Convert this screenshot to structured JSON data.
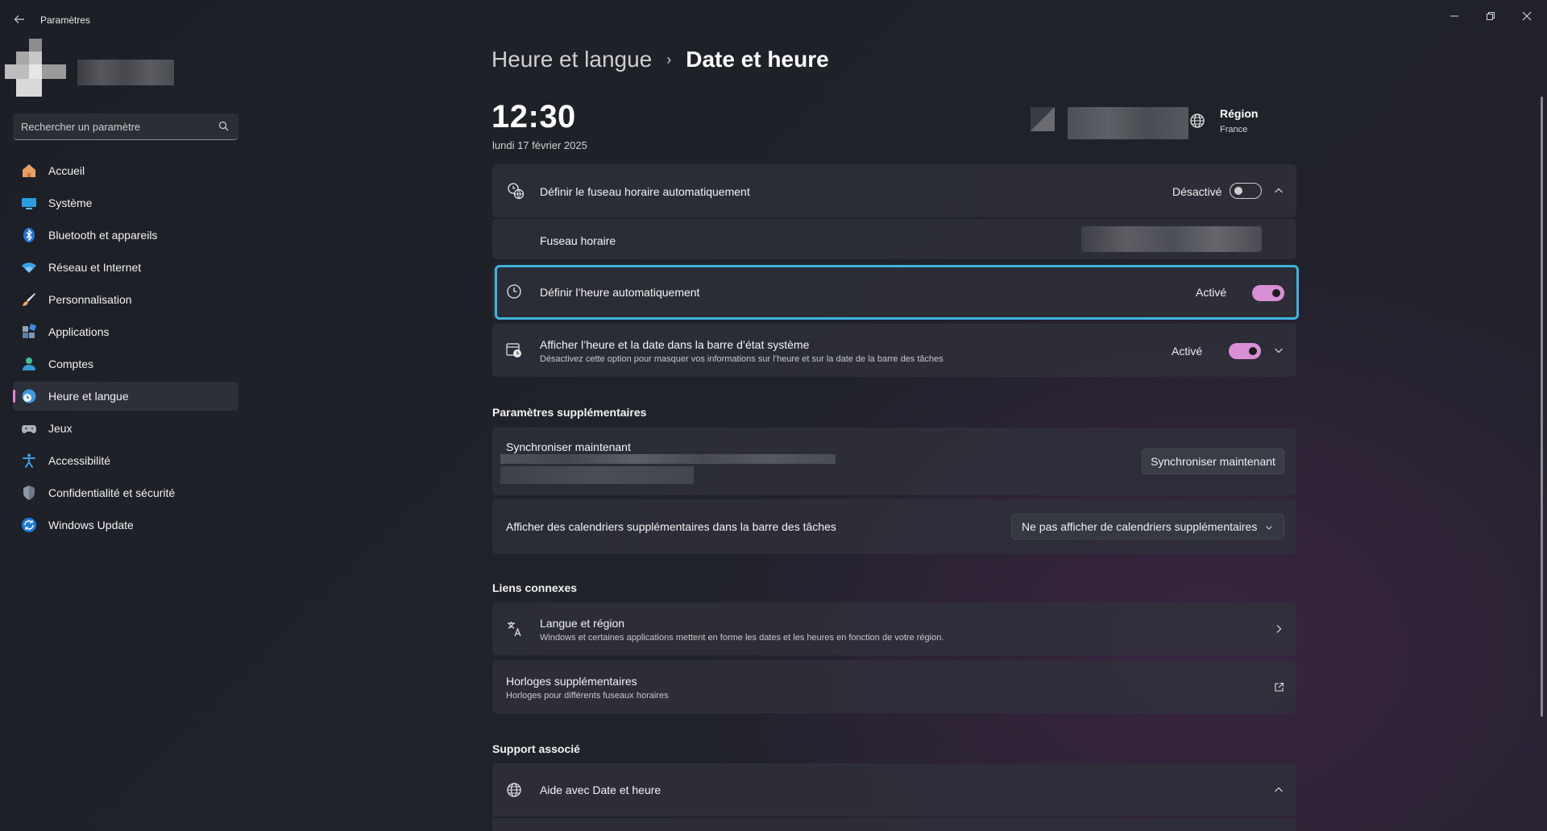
{
  "window": {
    "app_title": "Paramètres",
    "back_icon": "back-arrow-icon",
    "controls": [
      "minimize-icon",
      "restore-icon",
      "close-icon"
    ]
  },
  "search": {
    "placeholder": "Rechercher un paramètre",
    "icon": "search-icon"
  },
  "sidebar": {
    "items": [
      {
        "label": "Accueil",
        "icon": "home-icon",
        "active": false
      },
      {
        "label": "Système",
        "icon": "monitor-icon",
        "active": false
      },
      {
        "label": "Bluetooth et appareils",
        "icon": "bluetooth-icon",
        "active": false
      },
      {
        "label": "Réseau et Internet",
        "icon": "wifi-icon",
        "active": false
      },
      {
        "label": "Personnalisation",
        "icon": "brush-icon",
        "active": false
      },
      {
        "label": "Applications",
        "icon": "apps-icon",
        "active": false
      },
      {
        "label": "Comptes",
        "icon": "account-icon",
        "active": false
      },
      {
        "label": "Heure et langue",
        "icon": "globe-clock-icon",
        "active": true
      },
      {
        "label": "Jeux",
        "icon": "gamepad-icon",
        "active": false
      },
      {
        "label": "Accessibilité",
        "icon": "accessibility-icon",
        "active": false
      },
      {
        "label": "Confidentialité et sécurité",
        "icon": "shield-icon",
        "active": false
      },
      {
        "label": "Windows Update",
        "icon": "update-icon",
        "active": false
      }
    ]
  },
  "breadcrumb": {
    "parent": "Heure et langue",
    "separator": "›",
    "current": "Date et heure"
  },
  "clock": {
    "time": "12:30",
    "date": "lundi 17 février 2025"
  },
  "region": {
    "label": "Région",
    "value": "France",
    "icon": "globe-icon"
  },
  "settings": {
    "auto_timezone": {
      "label": "Définir le fuseau horaire automatiquement",
      "state": "Désactivé",
      "on": false,
      "icon": "globe-clock-icon"
    },
    "timezone": {
      "label": "Fuseau horaire"
    },
    "auto_time": {
      "label": "Définir l’heure automatiquement",
      "state": "Activé",
      "on": true,
      "icon": "clock-icon"
    },
    "show_tray": {
      "label": "Afficher l’heure et la date dans la barre d’état système",
      "sub": "Désactivez cette option pour masquer vos informations sur l’heure et sur la date de la barre des tâches",
      "state": "Activé",
      "on": true,
      "icon": "calendar-clock-icon"
    }
  },
  "extra": {
    "heading": "Paramètres supplémentaires",
    "sync": {
      "label": "Synchroniser maintenant",
      "button": "Synchroniser maintenant"
    },
    "calendars": {
      "label": "Afficher des calendriers supplémentaires dans la barre des tâches",
      "selected": "Ne pas afficher de calendriers supplémentaires"
    }
  },
  "related": {
    "heading": "Liens connexes",
    "language": {
      "label": "Langue et région",
      "sub": "Windows et certaines applications mettent en forme les dates et les heures en fonction de votre région.",
      "icon": "language-icon"
    },
    "clocks": {
      "label": "Horloges supplémentaires",
      "sub": "Horloges pour différents fuseaux horaires",
      "icon": "external-link-icon"
    }
  },
  "support": {
    "heading": "Support associé",
    "help": {
      "label": "Aide avec Date et heure",
      "icon": "globe-icon"
    }
  }
}
